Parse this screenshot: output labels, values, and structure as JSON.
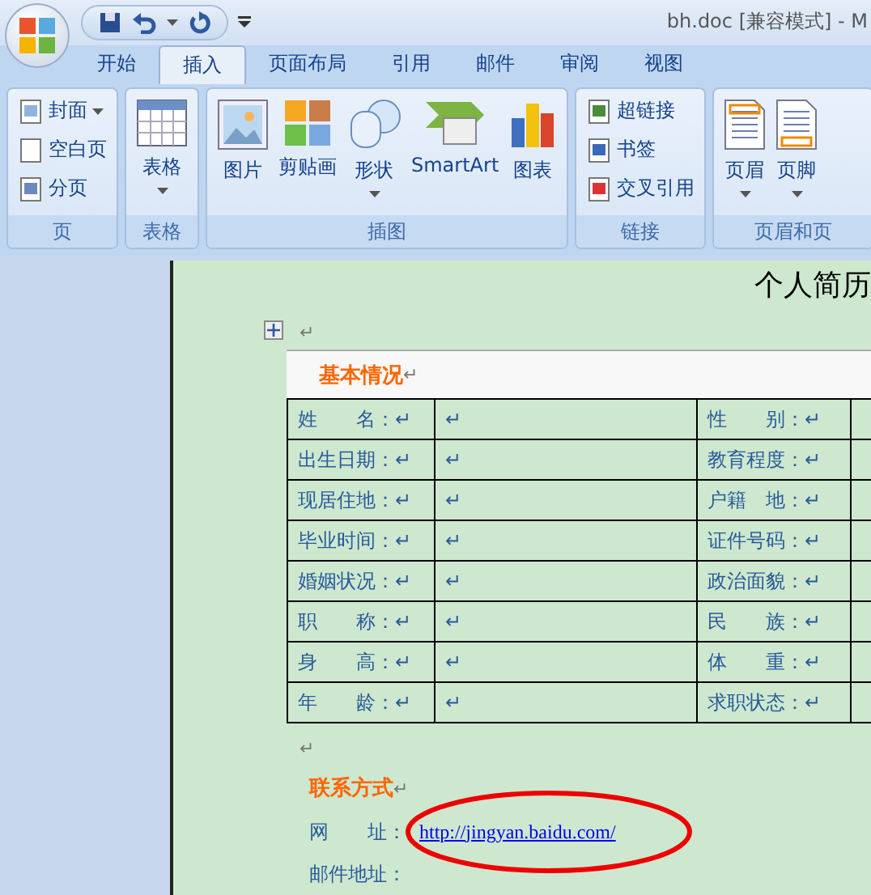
{
  "window": {
    "title": "bh.doc [兼容模式] - M"
  },
  "tabs": [
    {
      "label": "开始",
      "selected": false
    },
    {
      "label": "插入",
      "selected": true
    },
    {
      "label": "页面布局",
      "selected": false
    },
    {
      "label": "引用",
      "selected": false
    },
    {
      "label": "邮件",
      "selected": false
    },
    {
      "label": "审阅",
      "selected": false
    },
    {
      "label": "视图",
      "selected": false
    }
  ],
  "ribbon": {
    "groups": [
      {
        "label": "页",
        "items": [
          {
            "label": "封面",
            "kind": "small",
            "dropdown": true
          },
          {
            "label": "空白页",
            "kind": "small",
            "dropdown": false
          },
          {
            "label": "分页",
            "kind": "small",
            "dropdown": false
          }
        ]
      },
      {
        "label": "表格",
        "items": [
          {
            "label": "表格",
            "kind": "large",
            "dropdown": true
          }
        ]
      },
      {
        "label": "插图",
        "items": [
          {
            "label": "图片",
            "kind": "large",
            "dropdown": false
          },
          {
            "label": "剪贴画",
            "kind": "large",
            "dropdown": false
          },
          {
            "label": "形状",
            "kind": "large",
            "dropdown": true
          },
          {
            "label": "SmartArt",
            "kind": "large",
            "dropdown": false
          },
          {
            "label": "图表",
            "kind": "large",
            "dropdown": false
          }
        ]
      },
      {
        "label": "链接",
        "items": [
          {
            "label": "超链接",
            "kind": "small",
            "dropdown": false
          },
          {
            "label": "书签",
            "kind": "small",
            "dropdown": false
          },
          {
            "label": "交叉引用",
            "kind": "small",
            "dropdown": false
          }
        ]
      },
      {
        "label": "页眉和页",
        "items": [
          {
            "label": "页眉",
            "kind": "large",
            "dropdown": true
          },
          {
            "label": "页脚",
            "kind": "large",
            "dropdown": true
          }
        ]
      }
    ]
  },
  "document": {
    "title": "个人简历",
    "mark_before_table": "↵",
    "table": {
      "heading": "基本情况",
      "heading_mark": "↵",
      "rows": [
        {
          "cells": [
            "姓　　名：↵",
            "↵",
            "性　　别：↵"
          ]
        },
        {
          "cells": [
            "出生日期：↵",
            "↵",
            "教育程度：↵"
          ]
        },
        {
          "cells": [
            "现居住地：↵",
            "↵",
            "户籍　地：↵"
          ]
        },
        {
          "cells": [
            "毕业时间：↵",
            "↵",
            "证件号码：↵"
          ]
        },
        {
          "cells": [
            "婚姻状况：↵",
            "↵",
            "政治面貌：↵"
          ]
        },
        {
          "cells": [
            "职　　称：↵",
            "↵",
            "民　　族：↵"
          ]
        },
        {
          "cells": [
            "身　　高：↵",
            "↵",
            "体　　重：↵"
          ]
        },
        {
          "cells": [
            "年　　龄：↵",
            "↵",
            "求职状态：↵"
          ]
        }
      ]
    },
    "mark_after_table": "↵",
    "contact": {
      "heading": "联系方式",
      "heading_mark": "↵",
      "lines": [
        {
          "label": "网　　址：",
          "link": "http://jingyan.baidu.com/",
          "circled": true
        },
        {
          "label": "邮件地址："
        }
      ]
    }
  }
}
